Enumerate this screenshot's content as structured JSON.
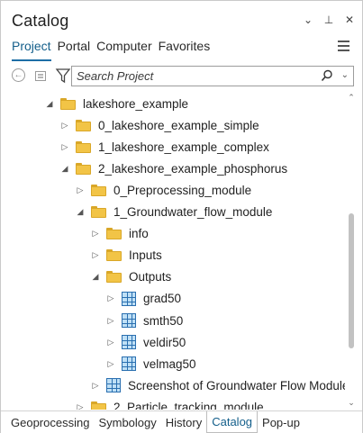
{
  "window": {
    "title": "Catalog",
    "controls": [
      {
        "icon": "chevron-down-icon",
        "glyph": "⌄"
      },
      {
        "icon": "pin-icon",
        "glyph": "⊥"
      },
      {
        "icon": "close-icon",
        "glyph": "✕"
      }
    ]
  },
  "tabs": [
    {
      "label": "Project",
      "active": true
    },
    {
      "label": "Portal",
      "active": false
    },
    {
      "label": "Computer",
      "active": false
    },
    {
      "label": "Favorites",
      "active": false
    }
  ],
  "toolbar": {
    "search_placeholder": "Search Project"
  },
  "tree": [
    {
      "label": "lakeshore_example",
      "icon": "folder-icon",
      "expanded": true,
      "level": 0
    },
    {
      "label": "0_lakeshore_example_simple",
      "icon": "folder-icon",
      "expanded": false,
      "level": 1
    },
    {
      "label": "1_lakeshore_example_complex",
      "icon": "folder-icon",
      "expanded": false,
      "level": 1
    },
    {
      "label": "2_lakeshore_example_phosphorus",
      "icon": "folder-icon",
      "expanded": true,
      "level": 1
    },
    {
      "label": "0_Preprocessing_module",
      "icon": "folder-icon",
      "expanded": false,
      "level": 2
    },
    {
      "label": "1_Groundwater_flow_module",
      "icon": "folder-icon",
      "expanded": true,
      "level": 2
    },
    {
      "label": "info",
      "icon": "folder-icon",
      "expanded": false,
      "level": 3
    },
    {
      "label": "Inputs",
      "icon": "folder-icon",
      "expanded": false,
      "level": 3
    },
    {
      "label": "Outputs",
      "icon": "folder-icon",
      "expanded": true,
      "level": 3
    },
    {
      "label": "grad50",
      "icon": "raster-icon",
      "expanded": false,
      "level": 4
    },
    {
      "label": "smth50",
      "icon": "raster-icon",
      "expanded": false,
      "level": 4
    },
    {
      "label": "veldir50",
      "icon": "raster-icon",
      "expanded": false,
      "level": 4
    },
    {
      "label": "velmag50",
      "icon": "raster-icon",
      "expanded": false,
      "level": 4
    },
    {
      "label": "Screenshot of Groundwater Flow Module.p...",
      "icon": "raster-icon",
      "expanded": false,
      "level": 3
    },
    {
      "label": "2_Particle_tracking_module",
      "icon": "folder-icon",
      "expanded": false,
      "level": 2
    }
  ],
  "bottom_tabs": [
    {
      "label": "Geoprocessing",
      "active": false
    },
    {
      "label": "Symbology",
      "active": false
    },
    {
      "label": "History",
      "active": false
    },
    {
      "label": "Catalog",
      "active": true
    },
    {
      "label": "Pop-up",
      "active": false
    }
  ],
  "colors": {
    "accent": "#1d6ea6",
    "folder": "#f2c446",
    "raster": "#2a6fb0"
  }
}
